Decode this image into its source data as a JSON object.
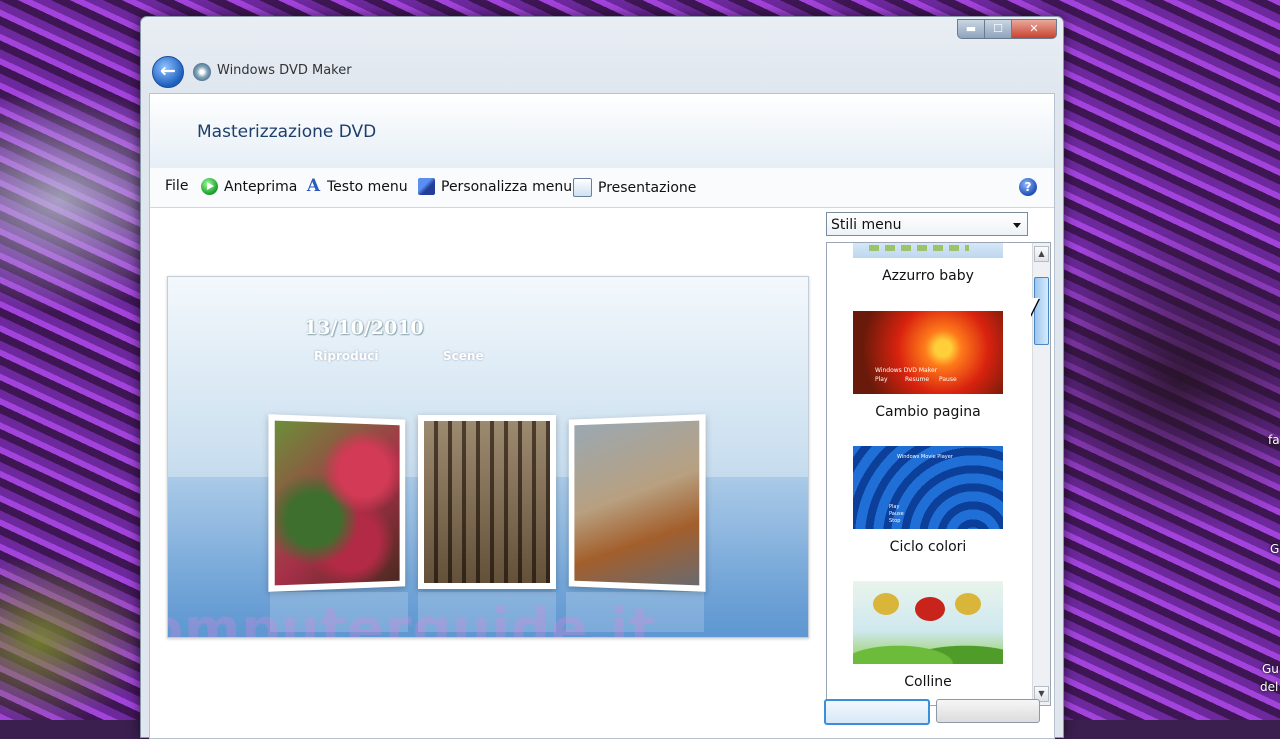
{
  "window": {
    "app_title": "Windows DVD Maker",
    "page_title": "Masterizzazione DVD",
    "caption": {
      "minimize": "▬",
      "maximize": "☐",
      "close": "✕"
    }
  },
  "toolbar": {
    "file": "File",
    "preview": "Anteprima",
    "menu_text": "Testo menu",
    "customize_menu": "Personalizza menu",
    "slideshow": "Presentazione",
    "help": "?"
  },
  "menu_preview": {
    "date": "13/10/2010",
    "play": "Riproduci",
    "scenes": "Scene",
    "watermark": "computerguide.it"
  },
  "styles": {
    "selected": "Stili menu",
    "items": [
      {
        "label": "Azzurro baby"
      },
      {
        "label": "Cambio pagina"
      },
      {
        "label": "Ciclo colori"
      },
      {
        "label": "Colline"
      }
    ],
    "thumb_texts": {
      "cambio_title": "Windows DVD Maker",
      "cambio_play": "Play",
      "cambio_resume": "Resume",
      "cambio_pause": "Pause",
      "ciclo_title": "Windows Movie Player",
      "ciclo_play": "Play",
      "ciclo_pause": "Pause",
      "ciclo_stop": "Stop"
    }
  },
  "desktop": {
    "icon_text_1": "fa",
    "icon_text_2": "G",
    "icon_text_3": "Gu",
    "icon_text_4": "del"
  }
}
